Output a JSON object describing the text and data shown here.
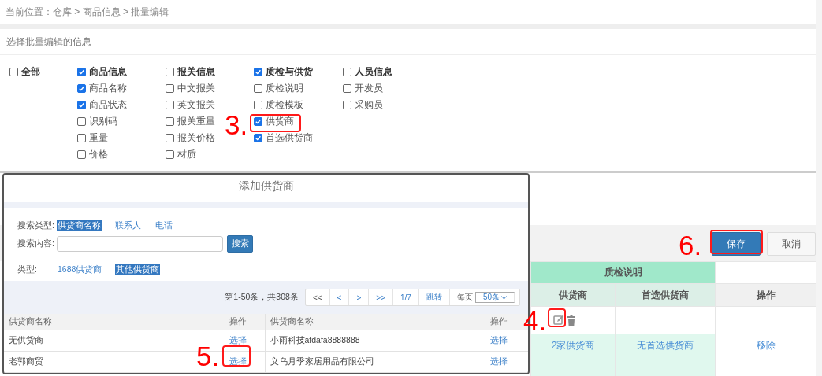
{
  "breadcrumb": "当前位置：仓库 > 商品信息 > 批量编辑",
  "panel_title": "选择批量编辑的信息",
  "field_groups": [
    {
      "label": "全部",
      "checked": false
    },
    {
      "label": "商品信息",
      "checked": true,
      "options": [
        {
          "label": "商品名称",
          "checked": true
        },
        {
          "label": "商品状态",
          "checked": true
        },
        {
          "label": "识别码",
          "checked": false
        },
        {
          "label": "重量",
          "checked": false
        },
        {
          "label": "价格",
          "checked": false
        }
      ]
    },
    {
      "label": "报关信息",
      "checked": false,
      "options": [
        {
          "label": "中文报关",
          "checked": false
        },
        {
          "label": "英文报关",
          "checked": false
        },
        {
          "label": "报关重量",
          "checked": false
        },
        {
          "label": "报关价格",
          "checked": false
        },
        {
          "label": "材质",
          "checked": false
        }
      ]
    },
    {
      "label": "质检与供货",
      "checked": true,
      "options": [
        {
          "label": "质检说明",
          "checked": false
        },
        {
          "label": "质检模板",
          "checked": false
        },
        {
          "label": "供货商",
          "checked": true
        },
        {
          "label": "首选供货商",
          "checked": true
        }
      ]
    },
    {
      "label": "人员信息",
      "checked": false,
      "options": [
        {
          "label": "开发员",
          "checked": false
        },
        {
          "label": "采购员",
          "checked": false
        }
      ]
    }
  ],
  "actions": [
    {
      "label": "保存",
      "kind": "primary"
    },
    {
      "label": "取消",
      "kind": "default"
    }
  ],
  "edit_table": {
    "group_header": "质检说明",
    "columns": [
      "供货商",
      "首选供货商",
      "操作"
    ],
    "rows": [
      {
        "kind": "icons"
      },
      {
        "kind": "links",
        "cells": [
          "2家供货商",
          "无首选供货商",
          "移除"
        ]
      }
    ]
  },
  "dialog": {
    "title": "添加供货商",
    "search_type_label": "搜索类型:",
    "search_types": [
      {
        "label": "供货商名称",
        "selected": true
      },
      {
        "label": "联系人",
        "selected": false
      },
      {
        "label": "电话",
        "selected": false
      }
    ],
    "search_content_label": "搜索内容:",
    "search_button": "搜索",
    "type_label": "类型:",
    "types": [
      {
        "label": "1688供货商",
        "selected": false
      },
      {
        "label": "其他供货商",
        "selected": true
      }
    ],
    "pagination": {
      "summary": "第1-50条，共308条",
      "buttons": [
        "<<",
        "<",
        ">",
        ">>",
        "1/7",
        "跳转"
      ],
      "per_page_label": "每页",
      "per_page": "50条"
    },
    "columns": [
      "供货商名称",
      "操作",
      "供货商名称",
      "操作"
    ],
    "rows": [
      [
        "无供货商",
        "选择",
        "小雨科技afdafa8888888",
        "选择"
      ],
      [
        "老郭商贸",
        "选择",
        "义乌月季家居用品有限公司",
        "选择"
      ]
    ]
  },
  "annotations": [
    {
      "label": "3."
    },
    {
      "label": "4."
    },
    {
      "label": "5."
    },
    {
      "label": "6."
    }
  ]
}
